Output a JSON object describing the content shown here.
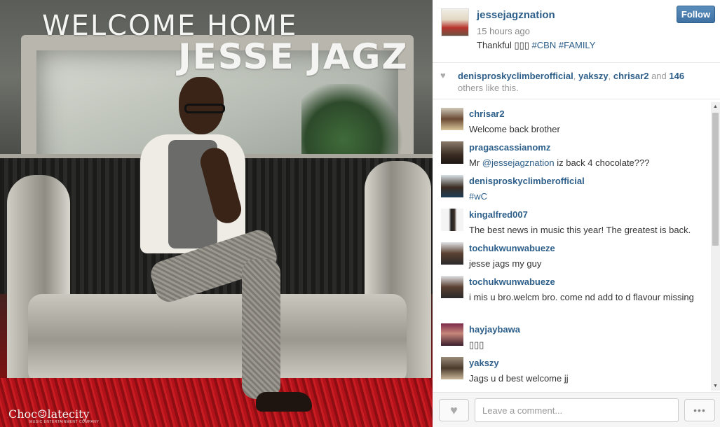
{
  "photo": {
    "title_line1": "WELCOME HOME",
    "title_line2": "JESSE JAGZ",
    "brand": "Choc☺latecity",
    "brand_sub": "MUSIC ENTERTAINMENT COMPANY"
  },
  "post": {
    "username": "jessejagznation",
    "time_ago": "15 hours ago",
    "caption_prefix": "Thankful ▯▯▯ ",
    "caption_tags": [
      "#CBN",
      "#FAMILY"
    ],
    "follow_label": "Follow"
  },
  "likes": {
    "users": [
      "denisproskyclimberofficial",
      "yakszy",
      "chrisar2"
    ],
    "and_label": "and",
    "count": "146",
    "suffix": "others like this."
  },
  "comments": [
    {
      "user": "chrisar2",
      "text": "Welcome back brother"
    },
    {
      "user": "pragascassianomz",
      "text_prefix": "Mr ",
      "mention": "@jessejagznation",
      "text_suffix": " iz back 4 chocolate???"
    },
    {
      "user": "denisproskyclimberofficial",
      "tag": "#wC"
    },
    {
      "user": "kingalfred007",
      "text": "The best news in music this year! The greatest is back."
    },
    {
      "user": "tochukwunwabueze",
      "text": "jesse jags my guy"
    },
    {
      "user": "tochukwunwabueze",
      "text": "i mis u bro.welcm bro. come nd add to d flavour missing"
    },
    {
      "user": "hayjaybawa",
      "text": "▯▯▯"
    },
    {
      "user": "yakszy",
      "text": "Jags u d best welcome jj"
    }
  ],
  "footer": {
    "comment_placeholder": "Leave a comment...",
    "more_label": "•••"
  },
  "colors": {
    "link": "#2d5f8a",
    "follow_button": "#3f72a3"
  }
}
